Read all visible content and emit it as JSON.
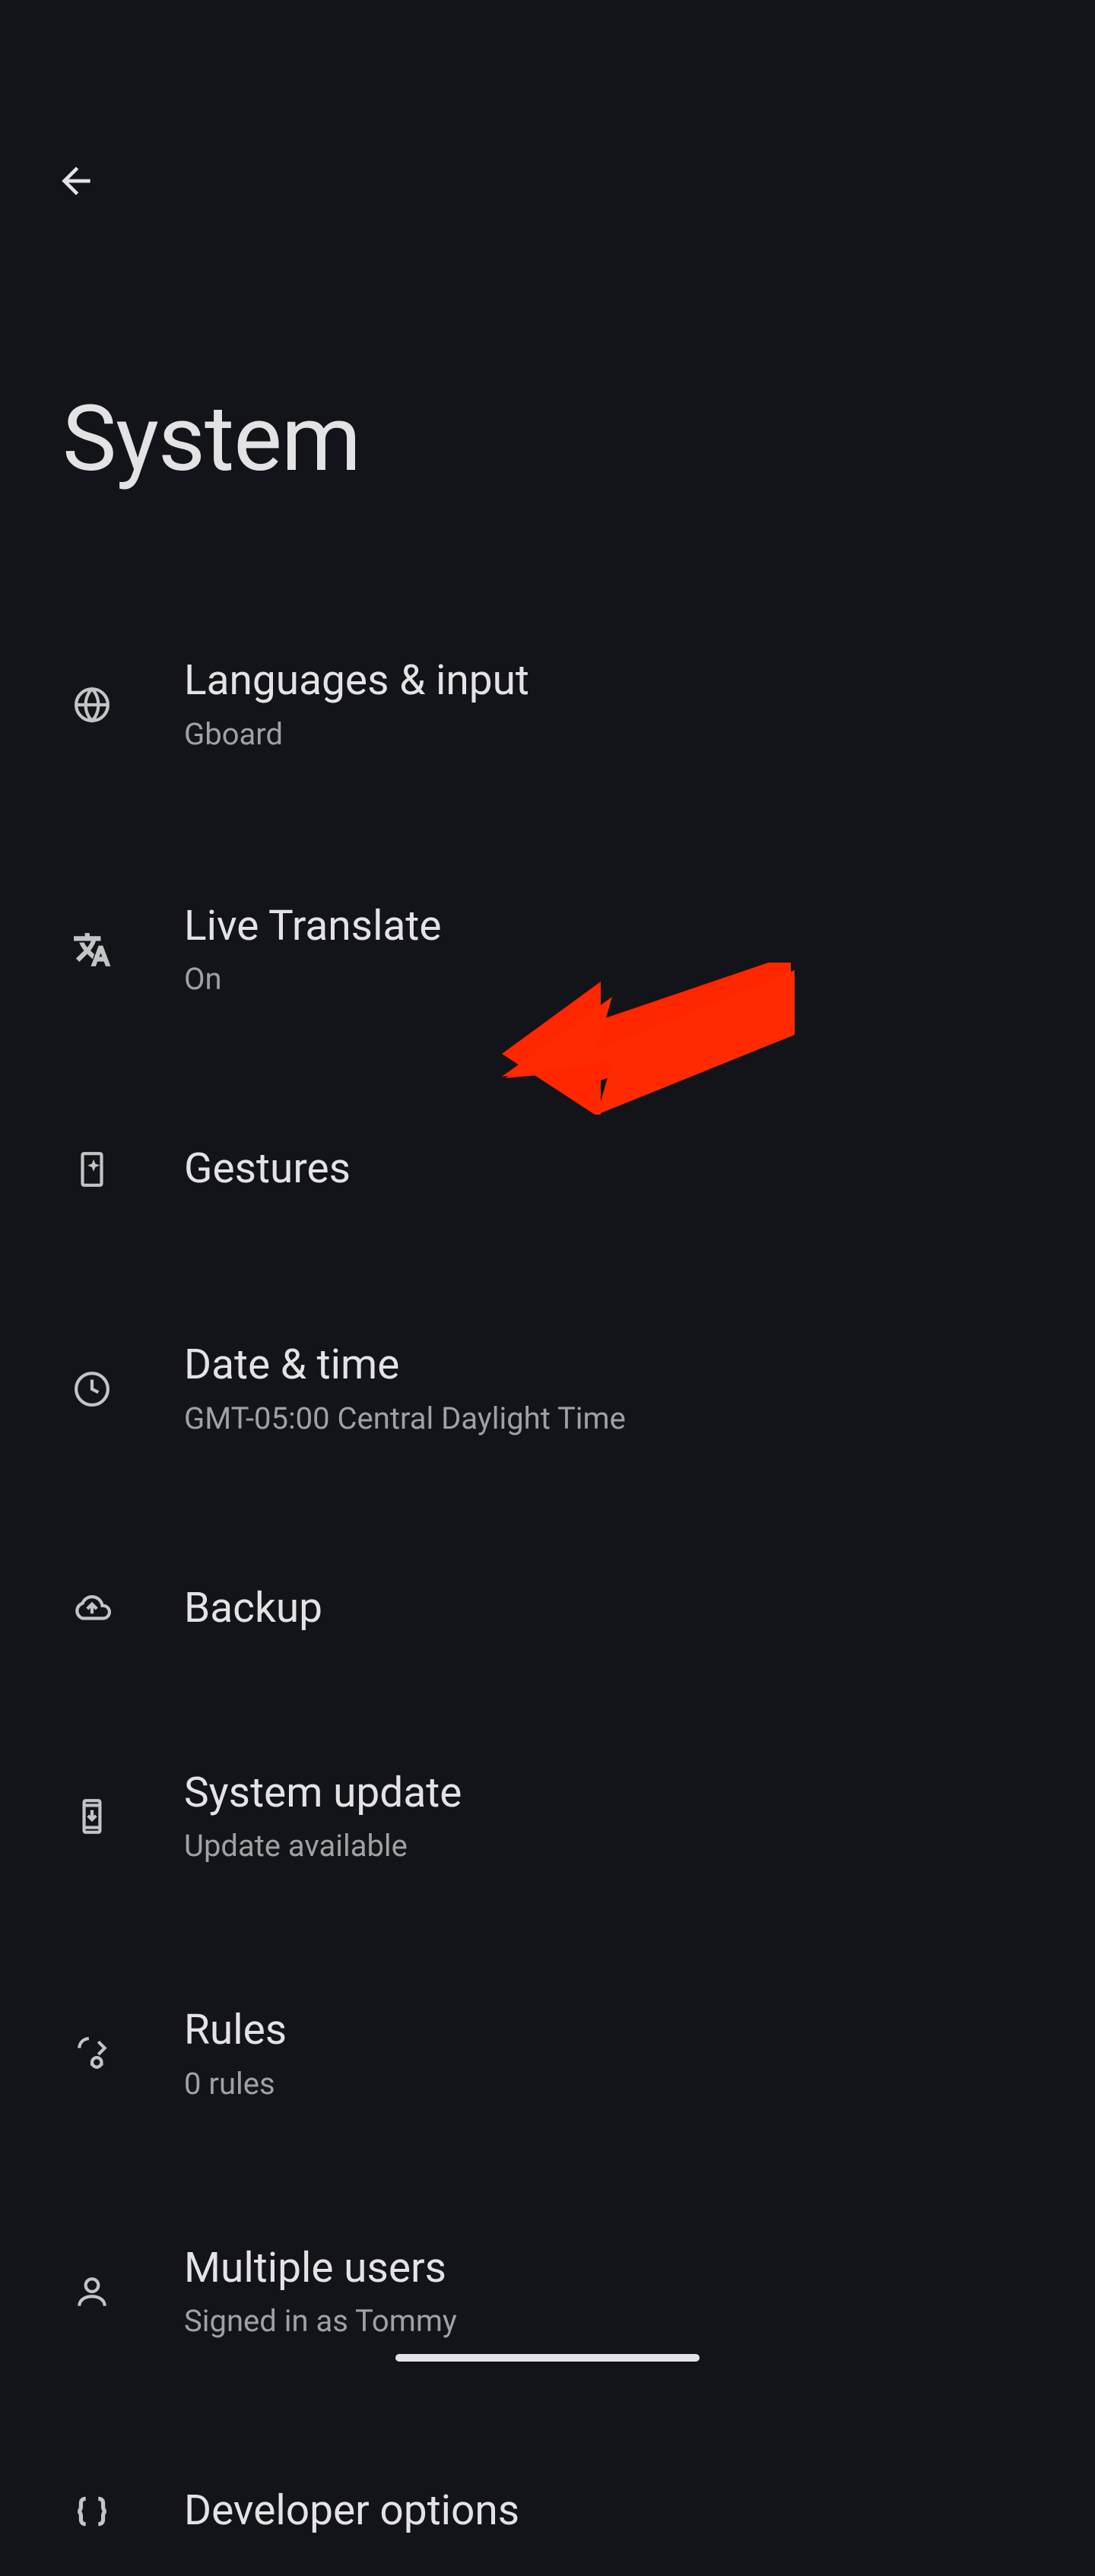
{
  "header": {
    "title": "System"
  },
  "settings": {
    "items": [
      {
        "id": "languages",
        "title": "Languages & input",
        "subtitle": "Gboard",
        "icon": "globe-icon"
      },
      {
        "id": "translate",
        "title": "Live Translate",
        "subtitle": "On",
        "icon": "translate-icon"
      },
      {
        "id": "gestures",
        "title": "Gestures",
        "subtitle": null,
        "icon": "phone-sparkle-icon"
      },
      {
        "id": "datetime",
        "title": "Date & time",
        "subtitle": "GMT-05:00 Central Daylight Time",
        "icon": "clock-icon"
      },
      {
        "id": "backup",
        "title": "Backup",
        "subtitle": null,
        "icon": "cloud-up-icon"
      },
      {
        "id": "update",
        "title": "System update",
        "subtitle": "Update available",
        "icon": "phone-download-icon"
      },
      {
        "id": "rules",
        "title": "Rules",
        "subtitle": "0 rules",
        "icon": "rules-icon"
      },
      {
        "id": "users",
        "title": "Multiple users",
        "subtitle": "Signed in as Tommy",
        "icon": "person-icon"
      },
      {
        "id": "developer",
        "title": "Developer options",
        "subtitle": null,
        "icon": "braces-icon"
      }
    ]
  }
}
